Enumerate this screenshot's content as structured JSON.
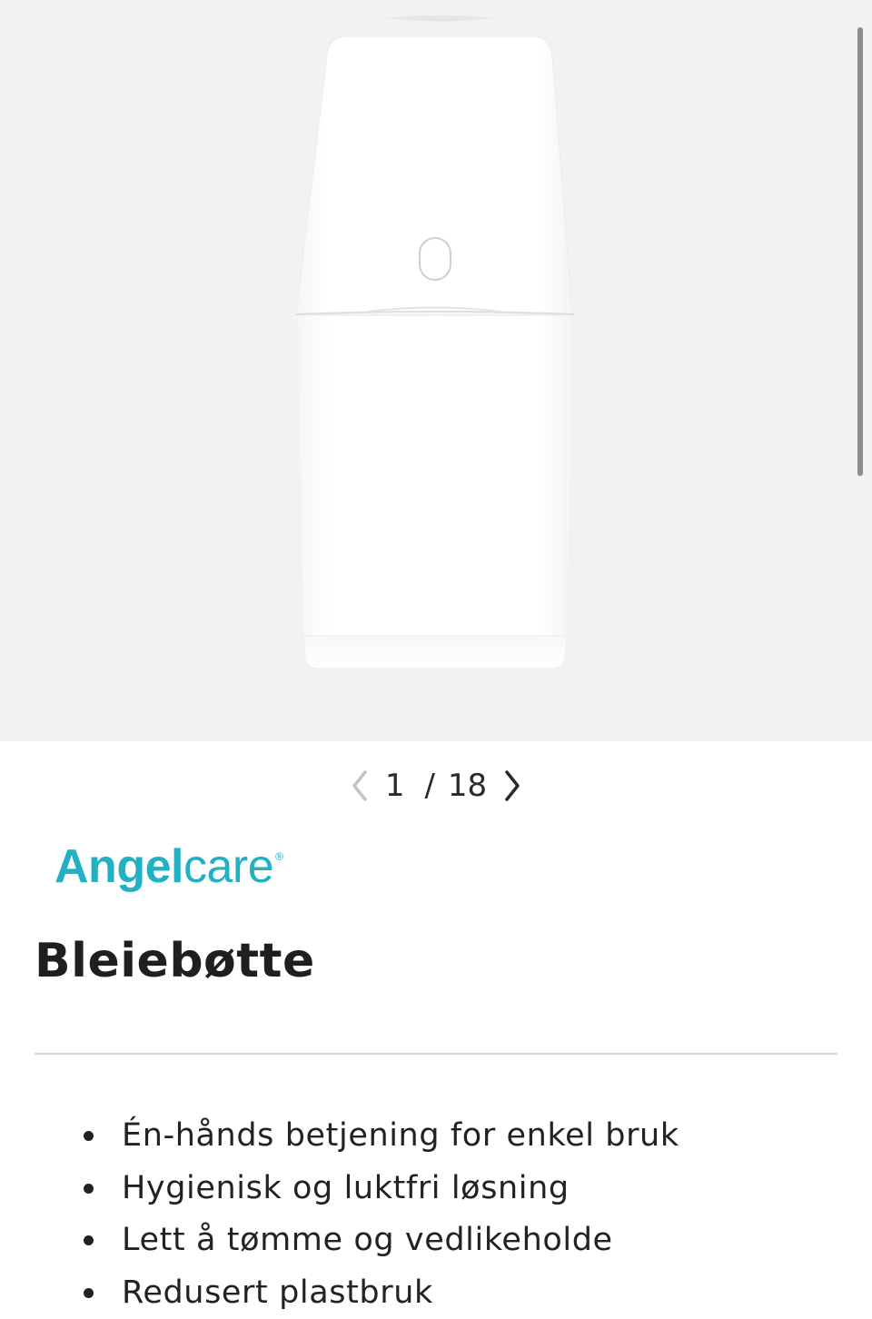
{
  "gallery": {
    "image_alt": "Bleiebøtte",
    "current_page": "1",
    "separator": "/",
    "total_pages": "18",
    "prev_icon": "chevron-left-icon",
    "next_icon": "chevron-right-icon"
  },
  "brand": {
    "name_bold": "Angel",
    "name_light": "care",
    "registered_mark": "®",
    "color": "#22b0c4"
  },
  "product": {
    "title": "Bleiebøtte",
    "features": [
      "Én-hånds betjening for enkel bruk",
      "Hygienisk og luktfri løsning",
      "Lett å tømme og vedlikeholde",
      "Redusert plastbruk"
    ]
  }
}
